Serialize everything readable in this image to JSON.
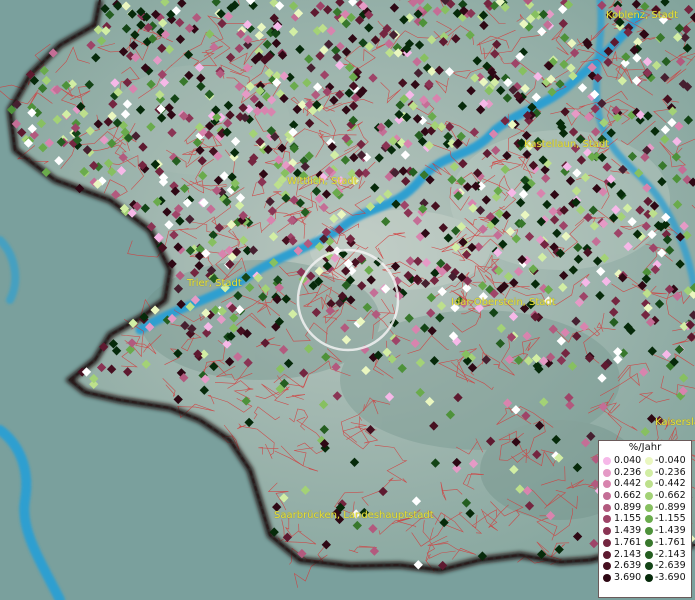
{
  "legend": {
    "title": "%/Jahr",
    "positive": [
      {
        "value": "0.040",
        "color": "#f6b8e8"
      },
      {
        "value": "0.236",
        "color": "#e59ac6"
      },
      {
        "value": "0.442",
        "color": "#d884ae"
      },
      {
        "value": "0.662",
        "color": "#c46e96"
      },
      {
        "value": "0.899",
        "color": "#b25a7e"
      },
      {
        "value": "1.155",
        "color": "#9e4468"
      },
      {
        "value": "1.439",
        "color": "#8a3454"
      },
      {
        "value": "1.761",
        "color": "#742640"
      },
      {
        "value": "2.143",
        "color": "#5e1a30"
      },
      {
        "value": "2.639",
        "color": "#461020"
      },
      {
        "value": "3.690",
        "color": "#2e0814"
      }
    ],
    "negative": [
      {
        "value": "-0.040",
        "color": "#eaf7c0"
      },
      {
        "value": "-0.236",
        "color": "#d2eea4"
      },
      {
        "value": "-0.442",
        "color": "#bde08c"
      },
      {
        "value": "-0.662",
        "color": "#a3d276"
      },
      {
        "value": "-0.899",
        "color": "#87c060"
      },
      {
        "value": "-1.155",
        "color": "#6aab4c"
      },
      {
        "value": "-1.439",
        "color": "#4e923a"
      },
      {
        "value": "-1.761",
        "color": "#38782c"
      },
      {
        "value": "-2.143",
        "color": "#245e20"
      },
      {
        "value": "-2.639",
        "color": "#134416"
      },
      {
        "value": "-3.690",
        "color": "#062a0a"
      }
    ]
  },
  "cities": [
    {
      "name": "Koblenz, Stadt"
    },
    {
      "name": "Wittlich, Stadt"
    },
    {
      "name": "Kastellaun, Stadt"
    },
    {
      "name": "Trier, Stadt"
    },
    {
      "name": "Idar-Oberstein, Stadt"
    },
    {
      "name": "Kaiserslautern"
    },
    {
      "name": "Saarbrücken, Landeshauptstadt"
    }
  ],
  "colors": {
    "land": "#8fb0a6",
    "outside": "#7a9f9c",
    "river": "#2f9fd0",
    "boundary": "#d43a3a",
    "border": "#1a1010",
    "label": "#e8e23a"
  }
}
